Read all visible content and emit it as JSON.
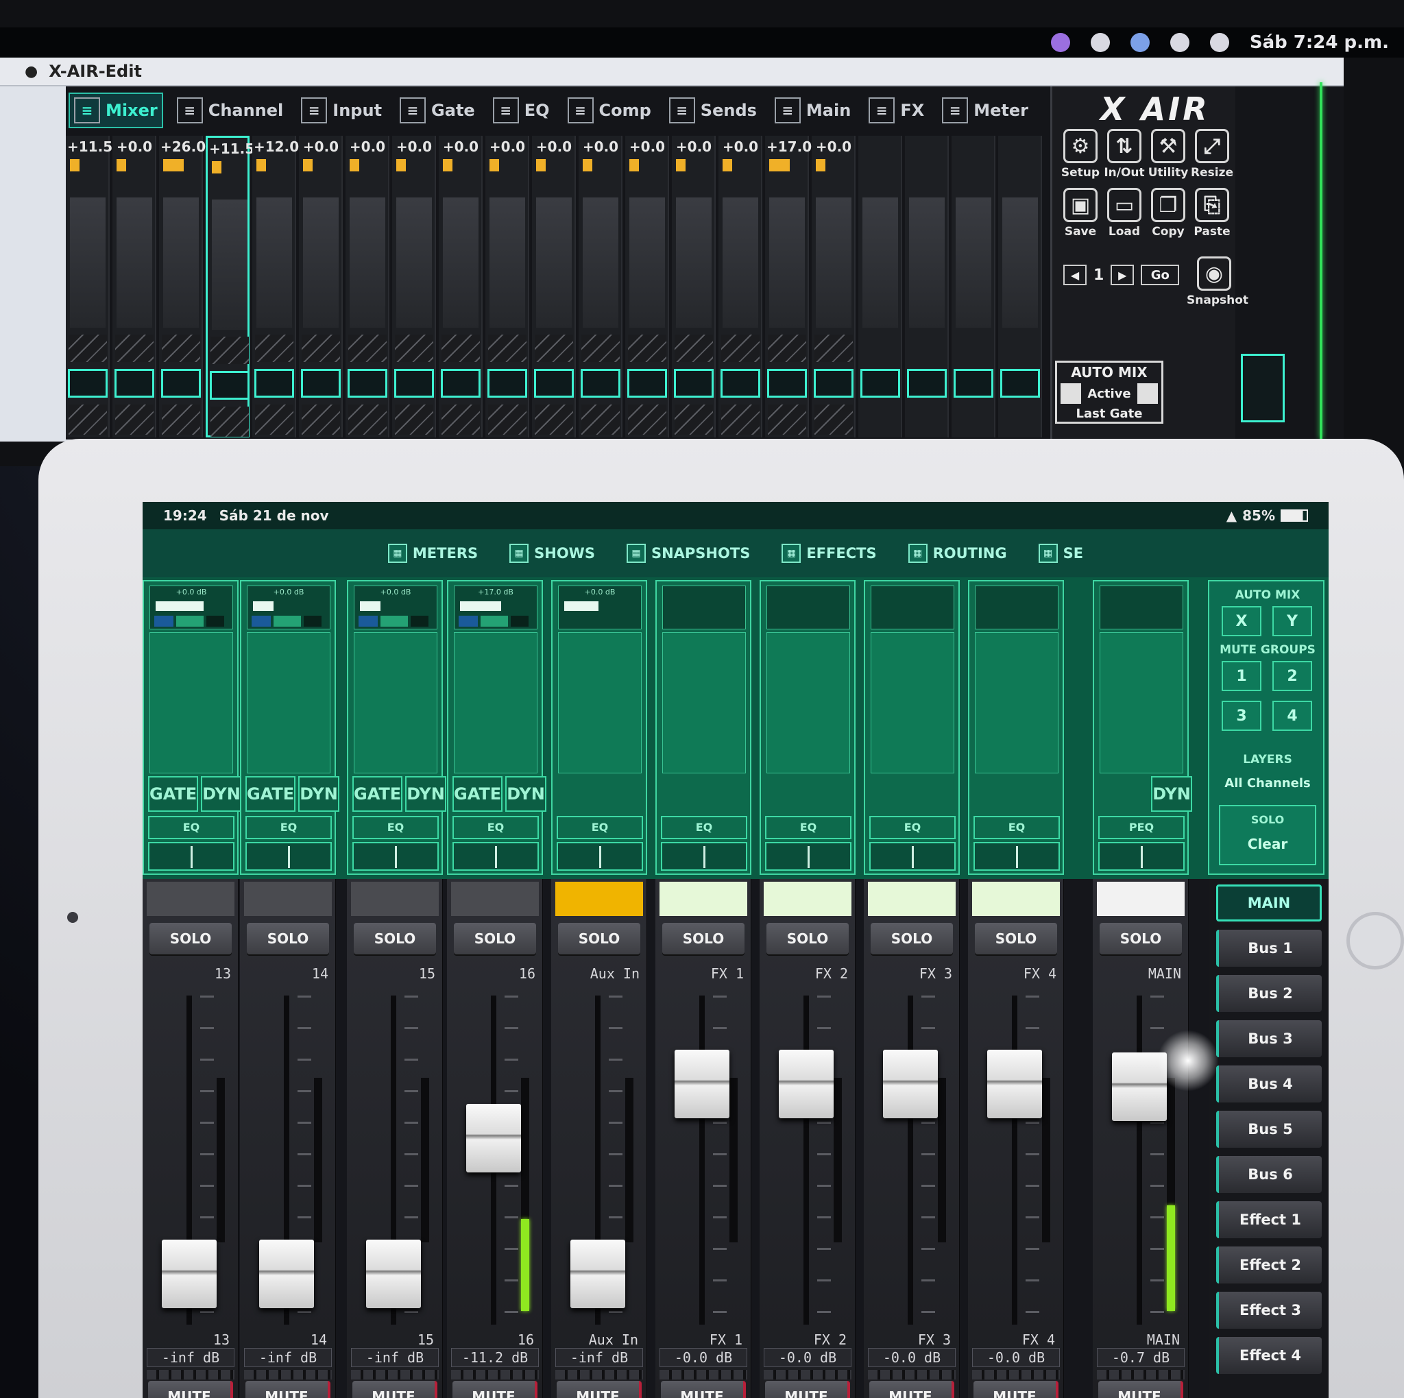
{
  "laptop": {
    "menubar": {
      "clock": "Sáb 7:24 p.m."
    },
    "window_title": "X-AIR-Edit",
    "tabs": [
      {
        "label": "Mixer",
        "icon": "mixer-icon",
        "active": true
      },
      {
        "label": "Channel",
        "icon": "channel-icon"
      },
      {
        "label": "Input",
        "icon": "input-icon"
      },
      {
        "label": "Gate",
        "icon": "gate-icon"
      },
      {
        "label": "EQ",
        "icon": "eq-icon"
      },
      {
        "label": "Comp",
        "icon": "comp-icon"
      },
      {
        "label": "Sends",
        "icon": "sends-icon"
      },
      {
        "label": "Main",
        "icon": "main-icon"
      },
      {
        "label": "FX",
        "icon": "fx-icon"
      },
      {
        "label": "Meter",
        "icon": "meter-icon"
      }
    ],
    "gains": [
      "+11.5",
      "+0.0",
      "+26.0",
      "+11.5",
      "+12.0",
      "+0.0",
      "+0.0",
      "+0.0",
      "+0.0",
      "+0.0",
      "+0.0",
      "+0.0",
      "+0.0",
      "+0.0",
      "+0.0",
      "+17.0",
      "+0.0"
    ],
    "logo": "X AIR",
    "panel_buttons": [
      {
        "label": "Setup",
        "icon": "gear-icon"
      },
      {
        "label": "In/Out",
        "icon": "arrows-updown-icon"
      },
      {
        "label": "Utility",
        "icon": "wrench-icon"
      },
      {
        "label": "Resize",
        "icon": "resize-icon"
      },
      {
        "label": "Save",
        "icon": "save-icon"
      },
      {
        "label": "Load",
        "icon": "folder-icon"
      },
      {
        "label": "Copy",
        "icon": "copy-icon"
      },
      {
        "label": "Paste",
        "icon": "paste-icon"
      }
    ],
    "snapshot_number": "1",
    "go_label": "Go",
    "snapshot_label": "Snapshot",
    "automix": {
      "title": "AUTO MIX",
      "active": "Active",
      "last_gate": "Last Gate"
    }
  },
  "ipad": {
    "status": {
      "time": "19:24",
      "date": "Sáb 21 de nov",
      "battery": "85%"
    },
    "nav": [
      {
        "label": "METERS",
        "icon": "meters-icon"
      },
      {
        "label": "SHOWS",
        "icon": "shows-icon"
      },
      {
        "label": "SNAPSHOTS",
        "icon": "camera-icon"
      },
      {
        "label": "EFFECTS",
        "icon": "effects-icon"
      },
      {
        "label": "ROUTING",
        "icon": "routing-icon"
      },
      {
        "label": "SE",
        "icon": "search-icon"
      }
    ],
    "gate_label": "GATE",
    "dyn_label": "DYN",
    "eq_label": "EQ",
    "peq_label": "PEQ",
    "solo_label": "SOLO",
    "mute_label": "MUTE",
    "right_panel": {
      "automix": "AUTO MIX",
      "x": "X",
      "y": "Y",
      "mute_groups": "MUTE GROUPS",
      "mg": [
        "1",
        "2",
        "3",
        "4"
      ],
      "layers": "LAYERS",
      "layers_value": "All Channels",
      "solo": "SOLO",
      "solo_clear": "Clear"
    },
    "channels": [
      {
        "name": "13",
        "db": "-inf dB",
        "gain": "+0.0 dB",
        "fader": 0.1,
        "meter": 0
      },
      {
        "name": "14",
        "db": "-inf dB",
        "gain": "+0.0 dB",
        "fader": 0.1,
        "meter": 0
      },
      {
        "name": "15",
        "db": "-inf dB",
        "gain": "+0.0 dB",
        "fader": 0.1,
        "meter": 0
      },
      {
        "name": "16",
        "db": "-11.2 dB",
        "gain": "+17.0 dB",
        "fader": 0.55,
        "meter": 0.28
      },
      {
        "name": "Aux In",
        "db": "-inf dB",
        "gain": "+0.0 dB",
        "fader": 0.1,
        "meter": 0
      },
      {
        "name": "FX 1",
        "db": "-0.0 dB",
        "gain": "",
        "fader": 0.73,
        "meter": 0
      },
      {
        "name": "FX 2",
        "db": "-0.0 dB",
        "gain": "",
        "fader": 0.73,
        "meter": 0
      },
      {
        "name": "FX 3",
        "db": "-0.0 dB",
        "gain": "",
        "fader": 0.73,
        "meter": 0
      },
      {
        "name": "FX 4",
        "db": "-0.0 dB",
        "gain": "",
        "fader": 0.73,
        "meter": 0
      },
      {
        "name": "MAIN",
        "db": "-0.7 dB",
        "gain": "",
        "fader": 0.72,
        "meter": 0.32
      }
    ],
    "buses": [
      "MAIN",
      "Bus 1",
      "Bus 2",
      "Bus 3",
      "Bus 4",
      "Bus 5",
      "Bus 6",
      "Effect 1",
      "Effect 2",
      "Effect 3",
      "Effect 4"
    ],
    "colors": {
      "accent": "#3df0d0",
      "meter": "#8fe820",
      "aux_tag": "#f0b400",
      "fx_tag": "#e6f8d8"
    }
  }
}
